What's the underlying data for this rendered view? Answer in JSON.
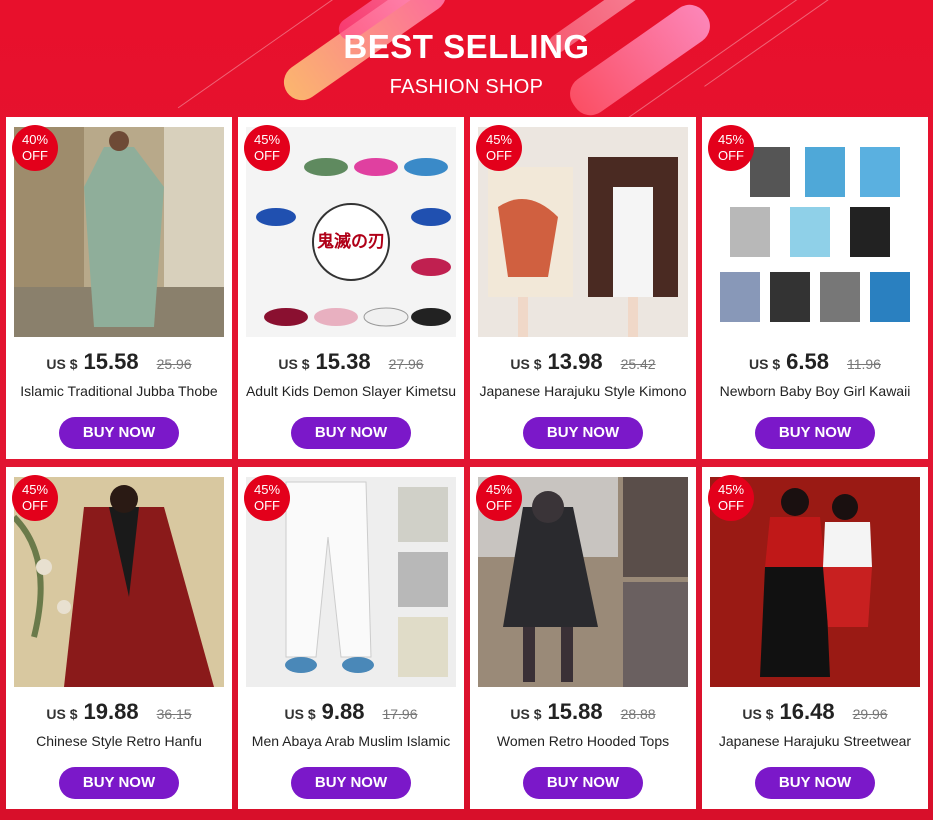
{
  "header": {
    "title": "BEST SELLING",
    "subtitle": "FASHION SHOP"
  },
  "products": [
    {
      "discount": "40%",
      "off": "OFF",
      "currency": "US $",
      "price": "15.58",
      "old_price": "25.96",
      "name": "Islamic Traditional Jubba Thobe",
      "button": "BUY NOW"
    },
    {
      "discount": "45%",
      "off": "OFF",
      "currency": "US $",
      "price": "15.38",
      "old_price": "27.96",
      "name": "Adult Kids Demon Slayer Kimetsu",
      "button": "BUY NOW",
      "logo_text": "鬼滅の刃"
    },
    {
      "discount": "45%",
      "off": "OFF",
      "currency": "US $",
      "price": "13.98",
      "old_price": "25.42",
      "name": "Japanese Harajuku Style Kimono",
      "button": "BUY NOW"
    },
    {
      "discount": "45%",
      "off": "OFF",
      "currency": "US $",
      "price": "6.58",
      "old_price": "11.96",
      "name": "Newborn Baby Boy Girl Kawaii",
      "button": "BUY NOW"
    },
    {
      "discount": "45%",
      "off": "OFF",
      "currency": "US $",
      "price": "19.88",
      "old_price": "36.15",
      "name": "Chinese Style Retro Hanfu",
      "button": "BUY NOW"
    },
    {
      "discount": "45%",
      "off": "OFF",
      "currency": "US $",
      "price": "9.88",
      "old_price": "17.96",
      "name": "Men Abaya Arab Muslim Islamic",
      "button": "BUY NOW"
    },
    {
      "discount": "45%",
      "off": "OFF",
      "currency": "US $",
      "price": "15.88",
      "old_price": "28.88",
      "name": "Women Retro Hooded Tops",
      "button": "BUY NOW"
    },
    {
      "discount": "45%",
      "off": "OFF",
      "currency": "US $",
      "price": "16.48",
      "old_price": "29.96",
      "name": "Japanese Harajuku Streetwear",
      "button": "BUY NOW"
    }
  ],
  "colors": {
    "background": "#e8132f",
    "badge": "#e3001b",
    "button": "#7b18c9"
  }
}
